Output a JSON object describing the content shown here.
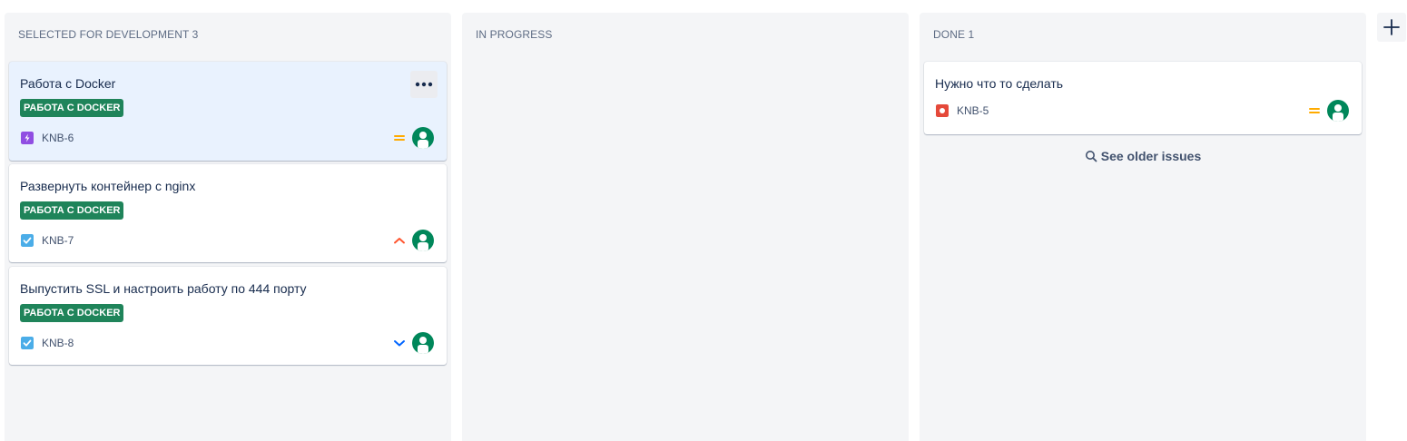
{
  "columns": [
    {
      "title": "SELECTED FOR DEVELOPMENT 3",
      "cards": [
        {
          "title": "Работа с Docker",
          "epic": "РАБОТА С DOCKER",
          "key": "KNB-6",
          "type": "subtask",
          "priority": "medium",
          "selected": true
        },
        {
          "title": "Развернуть контейнер с nginx",
          "epic": "РАБОТА С DOCKER",
          "key": "KNB-7",
          "type": "task",
          "priority": "high"
        },
        {
          "title": "Выпустить SSL и настроить работу по 444 порту",
          "epic": "РАБОТА С DOCKER",
          "key": "KNB-8",
          "type": "task",
          "priority": "low"
        }
      ]
    },
    {
      "title": "IN PROGRESS",
      "cards": []
    },
    {
      "title": "DONE 1",
      "cards": [
        {
          "title": "Нужно что то сделать",
          "key": "KNB-5",
          "type": "bug",
          "priority": "medium"
        }
      ],
      "see_older": "See older issues"
    }
  ],
  "icons": {
    "more": "more-icon",
    "add_column": "plus-icon",
    "search": "search-icon",
    "priority_medium": "priority-medium-icon",
    "priority_high": "priority-high-icon",
    "priority_low": "priority-low-icon",
    "type_subtask": "subtask-icon",
    "type_task": "task-icon",
    "type_bug": "bug-icon"
  },
  "colors": {
    "column_bg": "#f4f5f7",
    "selected_card_bg": "#e9f2fe",
    "epic_badge": "#1f845a",
    "avatar": "#00875a",
    "priority_medium": "#ffab00",
    "priority_high": "#ff5630",
    "priority_low": "#0065ff",
    "subtask": "#904ee2",
    "task": "#4bade8",
    "bug": "#e5493a"
  }
}
